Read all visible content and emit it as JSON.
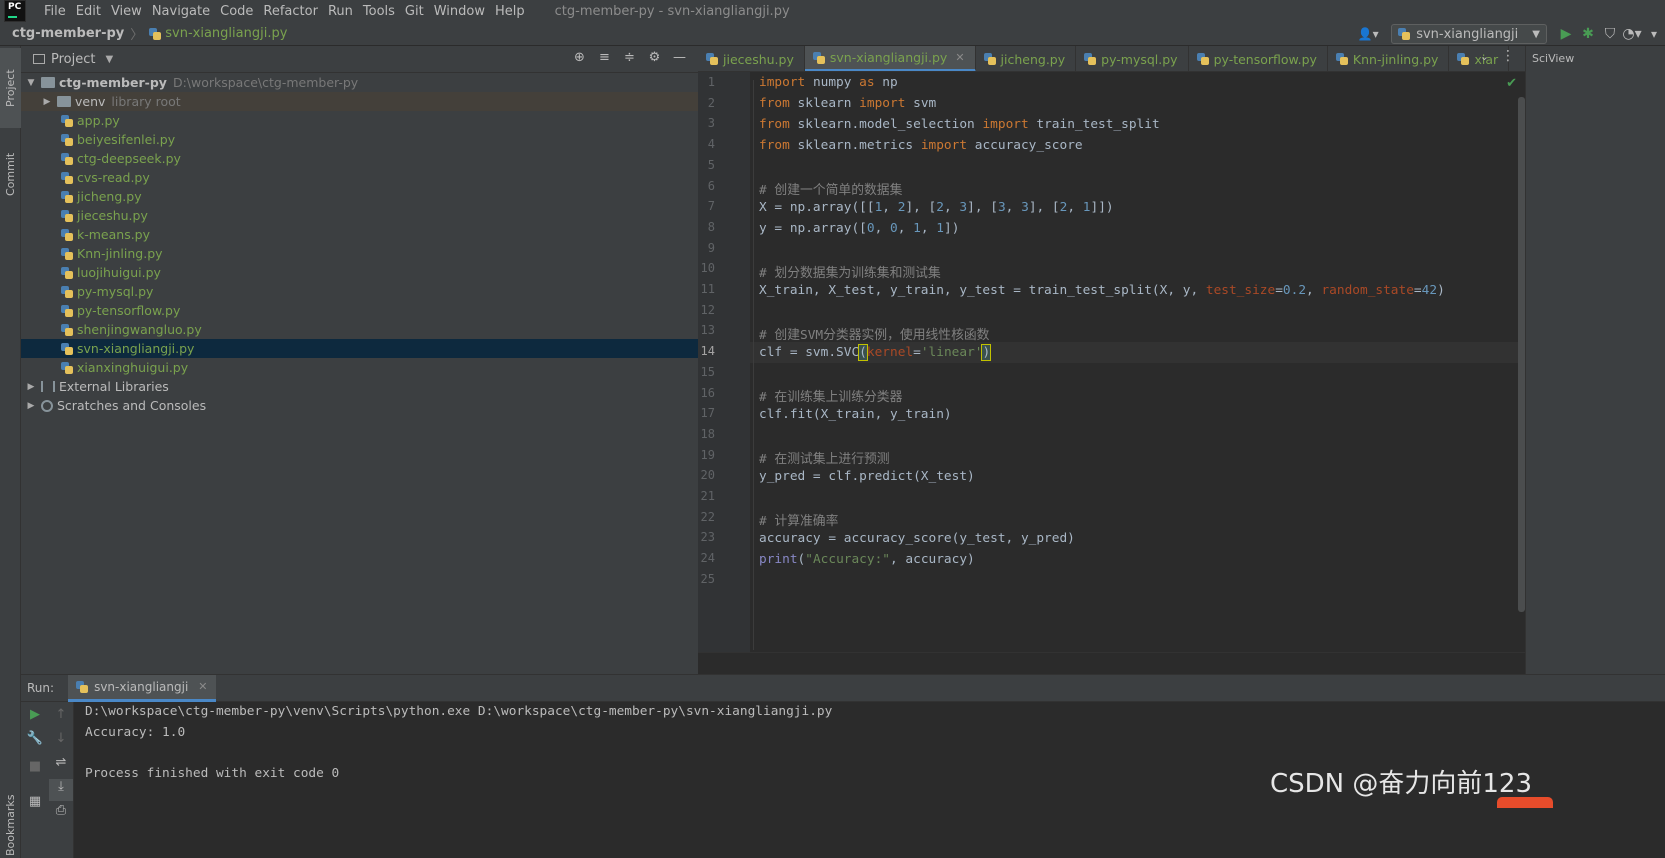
{
  "menubar": {
    "logo_text": "PC",
    "items": [
      "File",
      "Edit",
      "View",
      "Navigate",
      "Code",
      "Refactor",
      "Run",
      "Tools",
      "Git",
      "Window",
      "Help"
    ],
    "window_title": "ctg-member-py - svn-xiangliangji.py"
  },
  "navbar": {
    "project": "ctg-member-py",
    "file": "svn-xiangliangji.py",
    "run_config": "svn-xiangliangji"
  },
  "stripe": {
    "project": "Project",
    "commit": "Commit",
    "bookmarks": "Bookmarks"
  },
  "project_panel": {
    "title": "Project",
    "root_name": "ctg-member-py",
    "root_path": "D:\\workspace\\ctg-member-py",
    "venv_name": "venv",
    "venv_note": "library root",
    "files": [
      "app.py",
      "beiyesifenlei.py",
      "ctg-deepseek.py",
      "cvs-read.py",
      "jicheng.py",
      "jieceshu.py",
      "k-means.py",
      "Knn-jinling.py",
      "luojihuigui.py",
      "py-mysql.py",
      "py-tensorflow.py",
      "shenjingwangluo.py",
      "svn-xiangliangji.py",
      "xianxinghuigui.py"
    ],
    "selected_index": 12,
    "external_libraries": "External Libraries",
    "scratches": "Scratches and Consoles"
  },
  "editor_tabs": [
    "jieceshu.py",
    "svn-xiangliangji.py",
    "jicheng.py",
    "py-mysql.py",
    "py-tensorflow.py",
    "Knn-jinling.py",
    "xiar"
  ],
  "active_tab": 1,
  "sciview_label": "SciView",
  "editor": {
    "current_line": 14,
    "line_count": 25
  },
  "run_panel": {
    "label": "Run:",
    "tab": "svn-xiangliangji",
    "console_lines": [
      "D:\\workspace\\ctg-member-py\\venv\\Scripts\\python.exe D:\\workspace\\ctg-member-py\\svn-xiangliangji.py",
      "Accuracy: 1.0",
      "",
      "Process finished with exit code 0"
    ]
  },
  "watermark": "CSDN @奋力向前123",
  "colors": {
    "accent": "#4a88c7",
    "file_green": "#7aa24e",
    "run_green": "#499c54"
  }
}
